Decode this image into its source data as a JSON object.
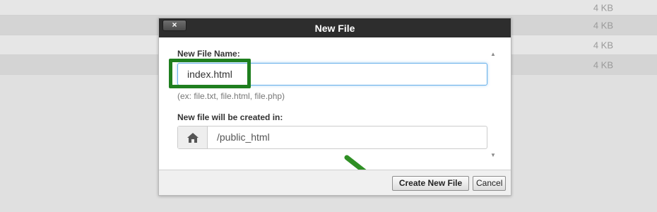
{
  "background": {
    "rows": [
      {
        "size": "4 KB",
        "alt": false,
        "first": true
      },
      {
        "size": "4 KB",
        "alt": true,
        "first": false
      },
      {
        "size": "4 KB",
        "alt": false,
        "first": false
      },
      {
        "size": "4 KB",
        "alt": true,
        "first": false
      }
    ]
  },
  "dialog": {
    "title": "New File",
    "close_label": "×",
    "file_name_label": "New File Name:",
    "file_name_value": "index.html",
    "file_name_hint": "(ex: file.txt, file.html, file.php)",
    "location_label": "New file will be created in:",
    "location_value": "/public_html",
    "location_icon": "home-icon",
    "create_button": "Create New File",
    "cancel_button": "Cancel"
  },
  "colors": {
    "header_bg": "#2d2d2d",
    "highlight_green": "#1f7f1f",
    "arrow_green": "#2f8f24",
    "focus_blue": "#66afe9"
  }
}
